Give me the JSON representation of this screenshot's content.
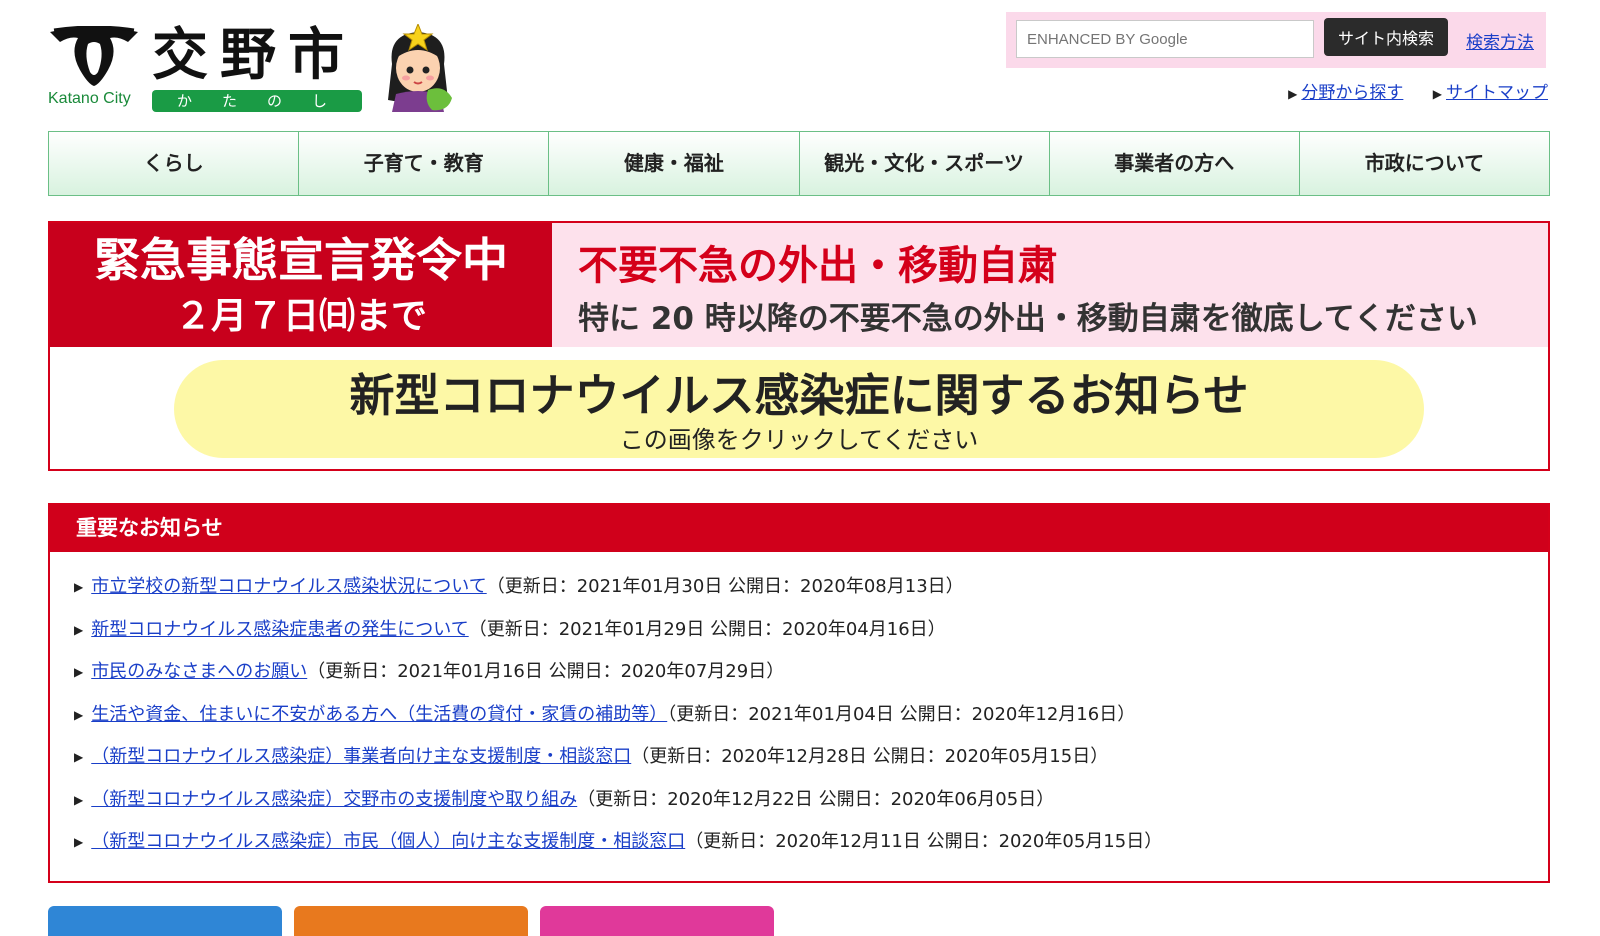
{
  "header": {
    "city_name": "交野市",
    "city_en": "Katano City",
    "city_kana": "かたのし",
    "search": {
      "placeholder": "ENHANCED BY Google",
      "button": "サイト内検索",
      "help": "検索方法"
    },
    "links": [
      {
        "label": "分野から探す"
      },
      {
        "label": "サイトマップ"
      }
    ]
  },
  "nav": [
    {
      "label": "くらし"
    },
    {
      "label": "子育て・教育"
    },
    {
      "label": "健康・福祉"
    },
    {
      "label": "観光・文化・スポーツ"
    },
    {
      "label": "事業者の方へ"
    },
    {
      "label": "市政について"
    }
  ],
  "emergency": {
    "left_title": "緊急事態宣言発令中",
    "left_date": "２月７日㈰まで",
    "right_title": "不要不急の外出・移動自粛",
    "right_text": "特に 20 時以降の不要不急の外出・移動自粛を徹底してください",
    "covid_title": "新型コロナウイルス感染症に関するお知らせ",
    "covid_sub": "この画像をクリックしてください"
  },
  "notices": {
    "title": "重要なお知らせ",
    "items": [
      {
        "link": "市立学校の新型コロナウイルス感染状況について",
        "dates": "（更新日：2021年01月30日 公開日：2020年08月13日）"
      },
      {
        "link": "新型コロナウイルス感染症患者の発生について",
        "dates": "（更新日：2021年01月29日 公開日：2020年04月16日）"
      },
      {
        "link": "市民のみなさまへのお願い",
        "dates": "（更新日：2021年01月16日 公開日：2020年07月29日）"
      },
      {
        "link": "生活や資金、住まいに不安がある方へ（生活費の貸付・家賃の補助等）",
        "dates": "（更新日：2021年01月04日 公開日：2020年12月16日）"
      },
      {
        "link": "（新型コロナウイルス感染症）事業者向け主な支援制度・相談窓口",
        "dates": "（更新日：2020年12月28日 公開日：2020年05月15日）"
      },
      {
        "link": "（新型コロナウイルス感染症）交野市の支援制度や取り組み",
        "dates": "（更新日：2020年12月22日 公開日：2020年06月05日）"
      },
      {
        "link": "（新型コロナウイルス感染症）市民（個人）向け主な支援制度・相談窓口",
        "dates": "（更新日：2020年12月11日 公開日：2020年05月15日）"
      }
    ]
  },
  "colors": {
    "accent_red": "#d0001b",
    "link_blue": "#1a3fc8",
    "nav_green": "#6bbf86",
    "search_pink": "#fbd9ea",
    "tab_blue": "#2f86d6",
    "tab_orange": "#e8791e",
    "tab_pink": "#e0399a"
  },
  "icons": [
    "city-emblem-icon",
    "mascot-icon",
    "triangle-right-icon"
  ]
}
